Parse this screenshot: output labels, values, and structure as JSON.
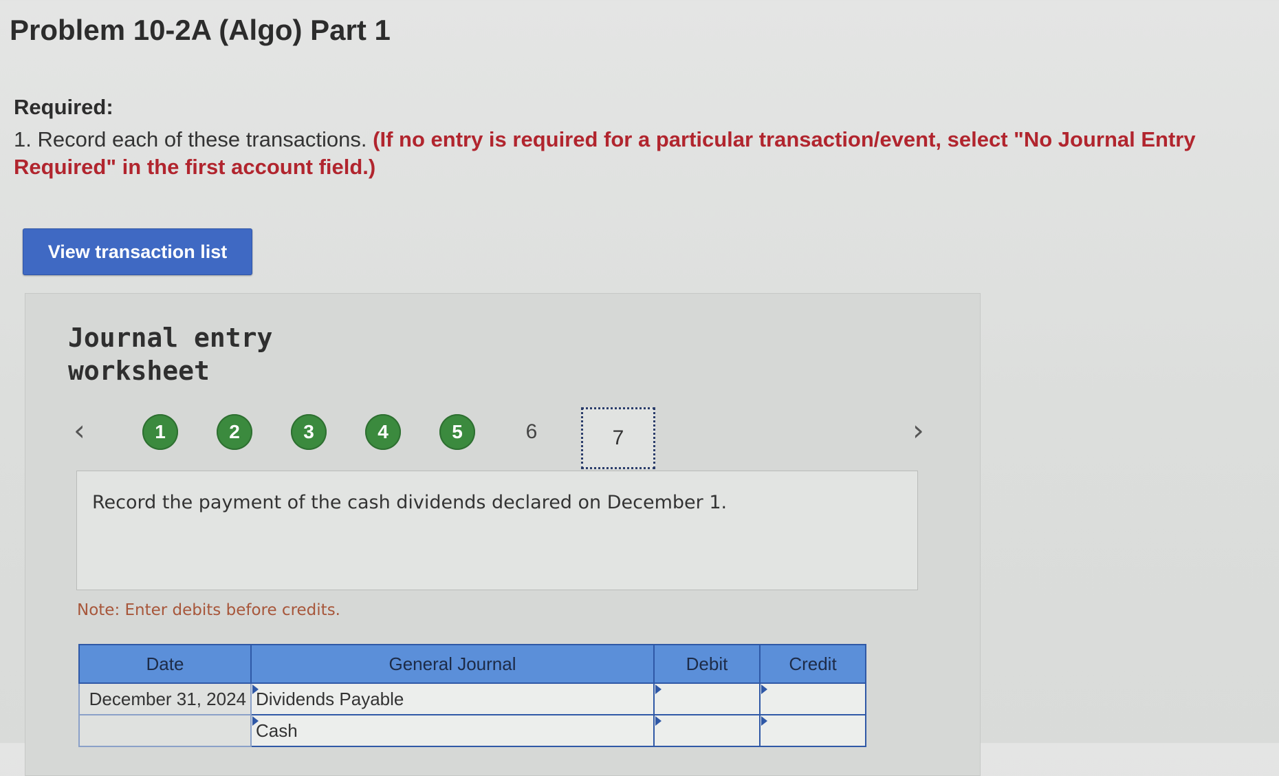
{
  "header": {
    "title": "Problem 10-2A (Algo) Part 1"
  },
  "required": {
    "label": "Required:",
    "number": "1.",
    "text": "Record each of these transactions.",
    "note": "(If no entry is required for a particular transaction/event, select \"No Journal Entry Required\" in the first account field.)"
  },
  "view_button": {
    "label": "View transaction list"
  },
  "worksheet": {
    "title": "Journal entry worksheet",
    "nav": {
      "prev_icon": "chevron-left-icon",
      "next_icon": "chevron-right-icon",
      "prev": "‹",
      "next": "›"
    },
    "steps": [
      "1",
      "2",
      "3",
      "4",
      "5",
      "6",
      "7"
    ],
    "completed_steps": [
      "1",
      "2",
      "3",
      "4",
      "5"
    ],
    "current_step": "7",
    "prompt": "Record the payment of the cash dividends declared on December 1.",
    "note": "Note: Enter debits before credits."
  },
  "journal": {
    "headers": {
      "date": "Date",
      "account": "General Journal",
      "debit": "Debit",
      "credit": "Credit"
    },
    "rows": [
      {
        "date": "December 31, 2024",
        "account": "Dividends Payable",
        "debit": "",
        "credit": ""
      },
      {
        "date": "",
        "account": "Cash",
        "debit": "",
        "credit": ""
      }
    ]
  },
  "colors": {
    "accent": "#3f69c3",
    "completed_step": "#3b8a3e",
    "instruction_red": "#b1252e",
    "table_header": "#5b8fd9"
  }
}
